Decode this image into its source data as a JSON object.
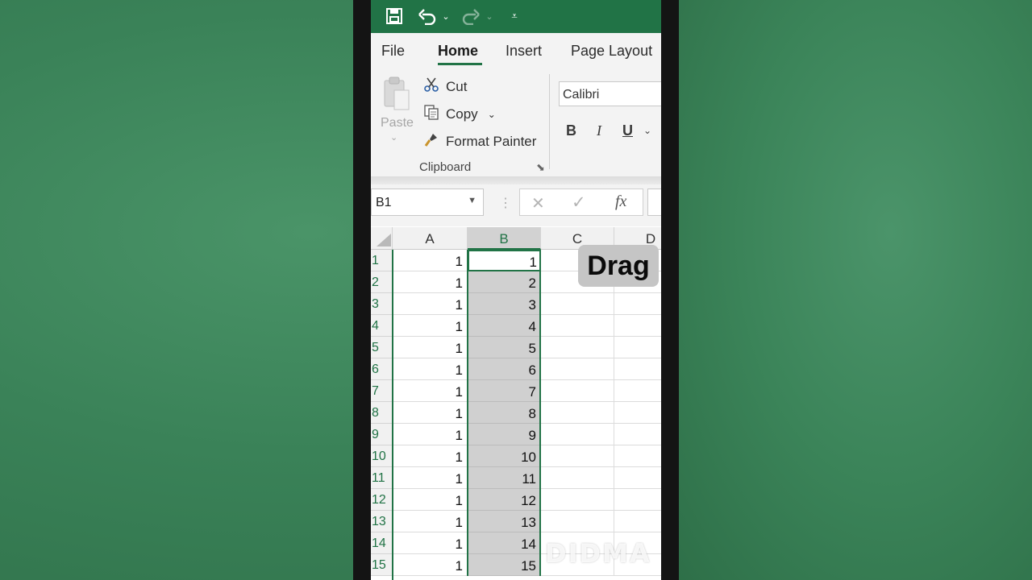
{
  "colors": {
    "accent": "#217346",
    "ribbon_bg": "#f3f3f3",
    "selection": "#d0d0d0"
  },
  "quick_access": {
    "save_icon": "save-icon",
    "undo_icon": "undo-icon",
    "redo_icon": "redo-icon",
    "customize_icon": "customize-icon"
  },
  "tabs": [
    {
      "label": "File",
      "active": false
    },
    {
      "label": "Home",
      "active": true
    },
    {
      "label": "Insert",
      "active": false
    },
    {
      "label": "Page Layout",
      "active": false
    }
  ],
  "clipboard": {
    "paste_label": "Paste",
    "cut_label": "Cut",
    "copy_label": "Copy",
    "format_painter_label": "Format Painter",
    "group_label": "Clipboard"
  },
  "font": {
    "name": "Calibri",
    "bold_label": "B",
    "italic_label": "I",
    "underline_label": "U"
  },
  "formula_bar": {
    "name_box": "B1",
    "cancel_glyph": "✕",
    "enter_glyph": "✓",
    "fx_label": "fx",
    "value": ""
  },
  "grid": {
    "columns": [
      "A",
      "B",
      "C",
      "D"
    ],
    "selected_column": "B",
    "active_cell": "B1",
    "rows": [
      {
        "num": "1",
        "a": "1",
        "b": "1"
      },
      {
        "num": "2",
        "a": "1",
        "b": "2"
      },
      {
        "num": "3",
        "a": "1",
        "b": "3"
      },
      {
        "num": "4",
        "a": "1",
        "b": "4"
      },
      {
        "num": "5",
        "a": "1",
        "b": "5"
      },
      {
        "num": "6",
        "a": "1",
        "b": "6"
      },
      {
        "num": "7",
        "a": "1",
        "b": "7"
      },
      {
        "num": "8",
        "a": "1",
        "b": "8"
      },
      {
        "num": "9",
        "a": "1",
        "b": "9"
      },
      {
        "num": "10",
        "a": "1",
        "b": "10"
      },
      {
        "num": "11",
        "a": "1",
        "b": "11"
      },
      {
        "num": "12",
        "a": "1",
        "b": "12"
      },
      {
        "num": "13",
        "a": "1",
        "b": "13"
      },
      {
        "num": "14",
        "a": "1",
        "b": "14"
      },
      {
        "num": "15",
        "a": "1",
        "b": "15"
      }
    ]
  },
  "overlay": {
    "drag_label": "Drag",
    "watermark": "DIDMA"
  }
}
